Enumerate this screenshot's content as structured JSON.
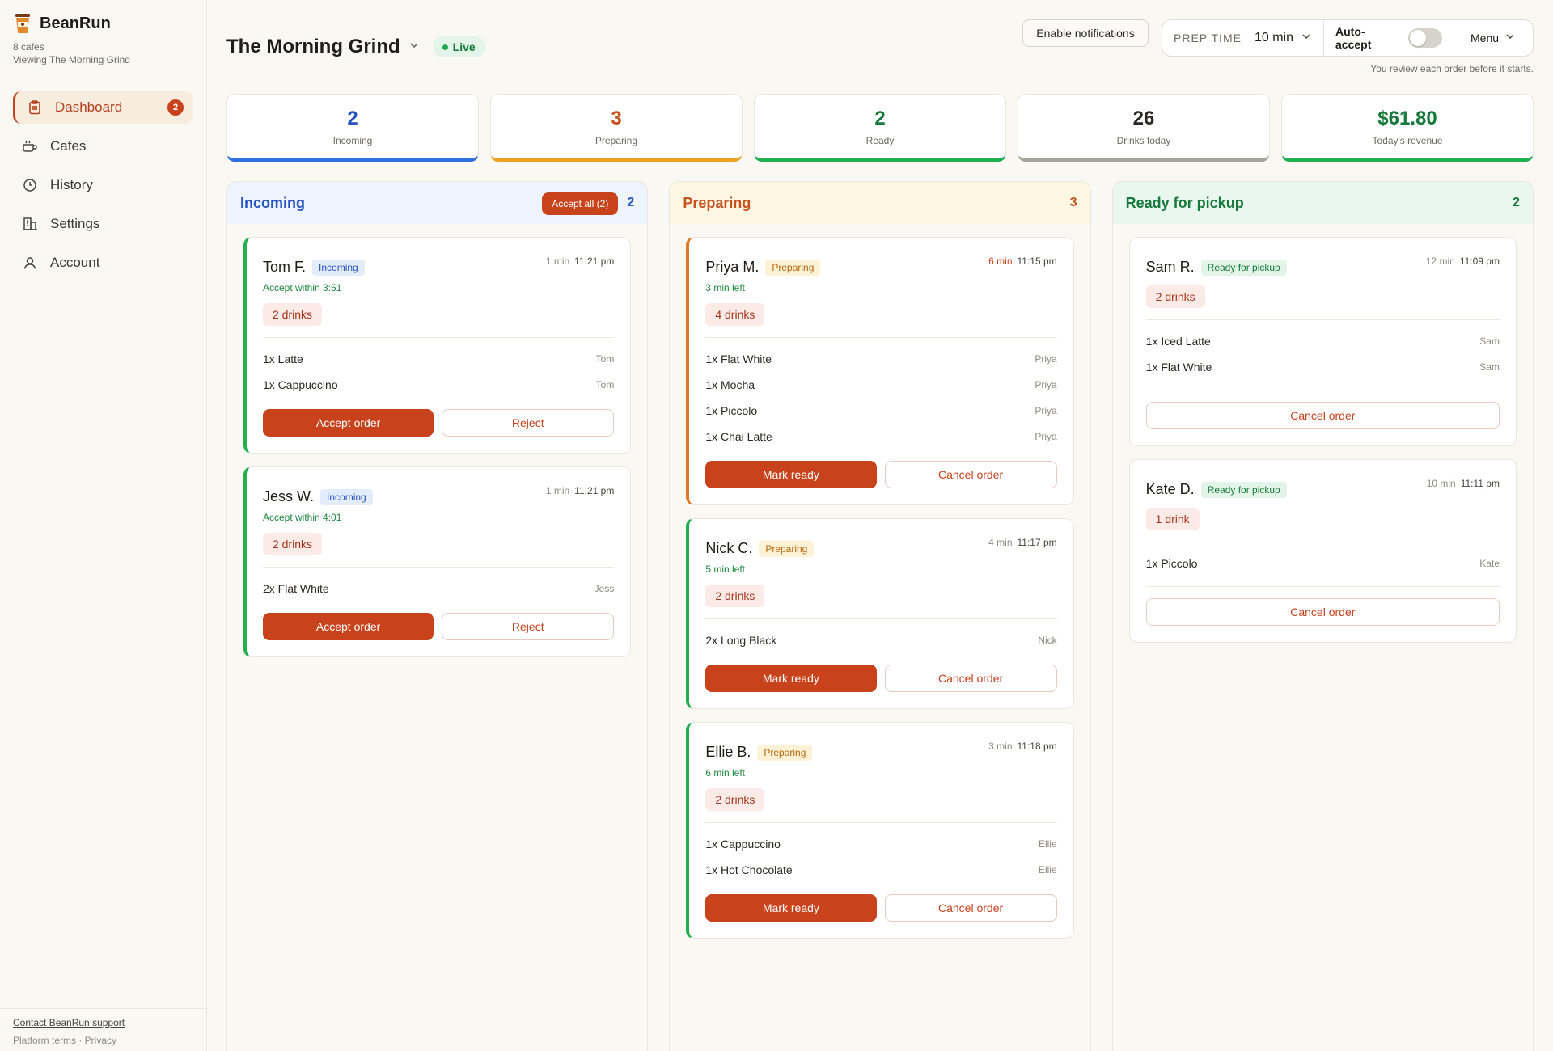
{
  "sidebar": {
    "brand": "BeanRun",
    "cafe_count": "8 cafes",
    "viewing": "Viewing The Morning Grind",
    "items": [
      {
        "label": "Dashboard",
        "badge": "2"
      },
      {
        "label": "Cafes"
      },
      {
        "label": "History"
      },
      {
        "label": "Settings"
      },
      {
        "label": "Account"
      }
    ],
    "support_link": "Contact BeanRun support",
    "footer_links": "Platform terms · Privacy"
  },
  "header": {
    "cafe_name": "The Morning Grind",
    "live_label": "Live",
    "notifications_button": "Enable notifications",
    "prep_time_label": "PREP TIME",
    "prep_time_value": "10 min",
    "auto_accept_label": "Auto-accept",
    "auto_accept_on": false,
    "menu_label": "Menu",
    "review_note": "You review each order before it starts."
  },
  "stats": [
    {
      "value": "2",
      "label": "Incoming",
      "color": "#2754c5",
      "accent": "#2f6fe0"
    },
    {
      "value": "3",
      "label": "Preparing",
      "color": "#c8521b",
      "accent": "#f0a020"
    },
    {
      "value": "2",
      "label": "Ready",
      "color": "#157a3a",
      "accent": "#22b04f"
    },
    {
      "value": "26",
      "label": "Drinks today",
      "color": "#2b2925",
      "accent": "#a8a49c"
    },
    {
      "value": "$61.80",
      "label": "Today's revenue",
      "color": "#157a3a",
      "accent": "#22b04f"
    }
  ],
  "columns": {
    "incoming": {
      "title": "Incoming",
      "count": "2",
      "accept_all": "Accept all (2)",
      "header_bg": "#eef4fd",
      "color": "#2754c5",
      "orders": [
        {
          "customer": "Tom F.",
          "status": "Incoming",
          "age": "1 min",
          "time": "11:21 pm",
          "countdown": "Accept within 3:51",
          "drinks": "2 drinks",
          "items": [
            {
              "name": "1x Latte",
              "owner": "Tom"
            },
            {
              "name": "1x Cappuccino",
              "owner": "Tom"
            }
          ],
          "primary": "Accept order",
          "secondary": "Reject"
        },
        {
          "customer": "Jess W.",
          "status": "Incoming",
          "age": "1 min",
          "time": "11:21 pm",
          "countdown": "Accept within 4:01",
          "drinks": "2 drinks",
          "items": [
            {
              "name": "2x Flat White",
              "owner": "Jess"
            }
          ],
          "primary": "Accept order",
          "secondary": "Reject"
        }
      ]
    },
    "preparing": {
      "title": "Preparing",
      "count": "3",
      "header_bg": "#fdf6e3",
      "color": "#c8521b",
      "orders": [
        {
          "customer": "Priya M.",
          "status": "Preparing",
          "age": "6 min",
          "age_warn": true,
          "time": "11:15 pm",
          "countdown": "3 min left",
          "drinks": "4 drinks",
          "items": [
            {
              "name": "1x Flat White",
              "owner": "Priya"
            },
            {
              "name": "1x Mocha",
              "owner": "Priya"
            },
            {
              "name": "1x Piccolo",
              "owner": "Priya"
            },
            {
              "name": "1x Chai Latte",
              "owner": "Priya"
            }
          ],
          "primary": "Mark ready",
          "secondary": "Cancel order"
        },
        {
          "customer": "Nick C.",
          "status": "Preparing",
          "age": "4 min",
          "time": "11:17 pm",
          "countdown": "5 min left",
          "drinks": "2 drinks",
          "items": [
            {
              "name": "2x Long Black",
              "owner": "Nick"
            }
          ],
          "primary": "Mark ready",
          "secondary": "Cancel order"
        },
        {
          "customer": "Ellie B.",
          "status": "Preparing",
          "age": "3 min",
          "time": "11:18 pm",
          "countdown": "6 min left",
          "drinks": "2 drinks",
          "items": [
            {
              "name": "1x Cappuccino",
              "owner": "Ellie"
            },
            {
              "name": "1x Hot Chocolate",
              "owner": "Ellie"
            }
          ],
          "primary": "Mark ready",
          "secondary": "Cancel order"
        }
      ]
    },
    "ready": {
      "title": "Ready for pickup",
      "count": "2",
      "header_bg": "#eaf7ee",
      "color": "#157a3a",
      "orders": [
        {
          "customer": "Sam R.",
          "status": "Ready for pickup",
          "age": "12 min",
          "time": "11:09 pm",
          "drinks": "2 drinks",
          "items": [
            {
              "name": "1x Iced Latte",
              "owner": "Sam"
            },
            {
              "name": "1x Flat White",
              "owner": "Sam"
            }
          ],
          "secondary": "Cancel order"
        },
        {
          "customer": "Kate D.",
          "status": "Ready for pickup",
          "age": "10 min",
          "time": "11:11 pm",
          "drinks": "1 drink",
          "items": [
            {
              "name": "1x Piccolo",
              "owner": "Kate"
            }
          ],
          "secondary": "Cancel order"
        }
      ]
    }
  }
}
